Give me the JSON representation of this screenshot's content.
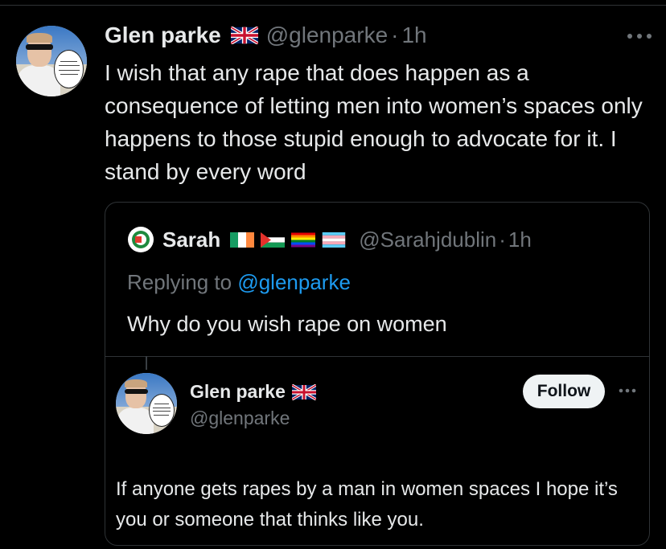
{
  "post": {
    "author_name": "Glen parke",
    "author_flag": "uk-flag-icon",
    "handle": "@glenparke",
    "separator": "·",
    "time": "1h",
    "text": "I wish that any rape that does happen as a consequence of letting men into women’s spaces only happens to those stupid enough to advocate for it.  I stand by every word"
  },
  "quote": {
    "author_name": "Sarah",
    "flags": [
      "ireland-flag-icon",
      "palestine-flag-icon",
      "rainbow-flag-icon",
      "transgender-flag-icon"
    ],
    "handle": "@Sarahjdublin",
    "separator": "·",
    "time": "1h",
    "replying_prefix": "Replying to",
    "replying_to": "@glenparke",
    "text": "Why do you wish rape on women"
  },
  "embedded": {
    "author_name": "Glen parke",
    "author_flag": "uk-flag-icon",
    "handle": "@glenparke",
    "follow_label": "Follow",
    "text": "If anyone gets rapes by a man in women spaces I hope it’s you or someone that thinks like you."
  },
  "colors": {
    "background": "#000000",
    "text": "#e7e9ea",
    "muted": "#71767b",
    "link": "#1d9bf0",
    "border": "#2f3336"
  }
}
